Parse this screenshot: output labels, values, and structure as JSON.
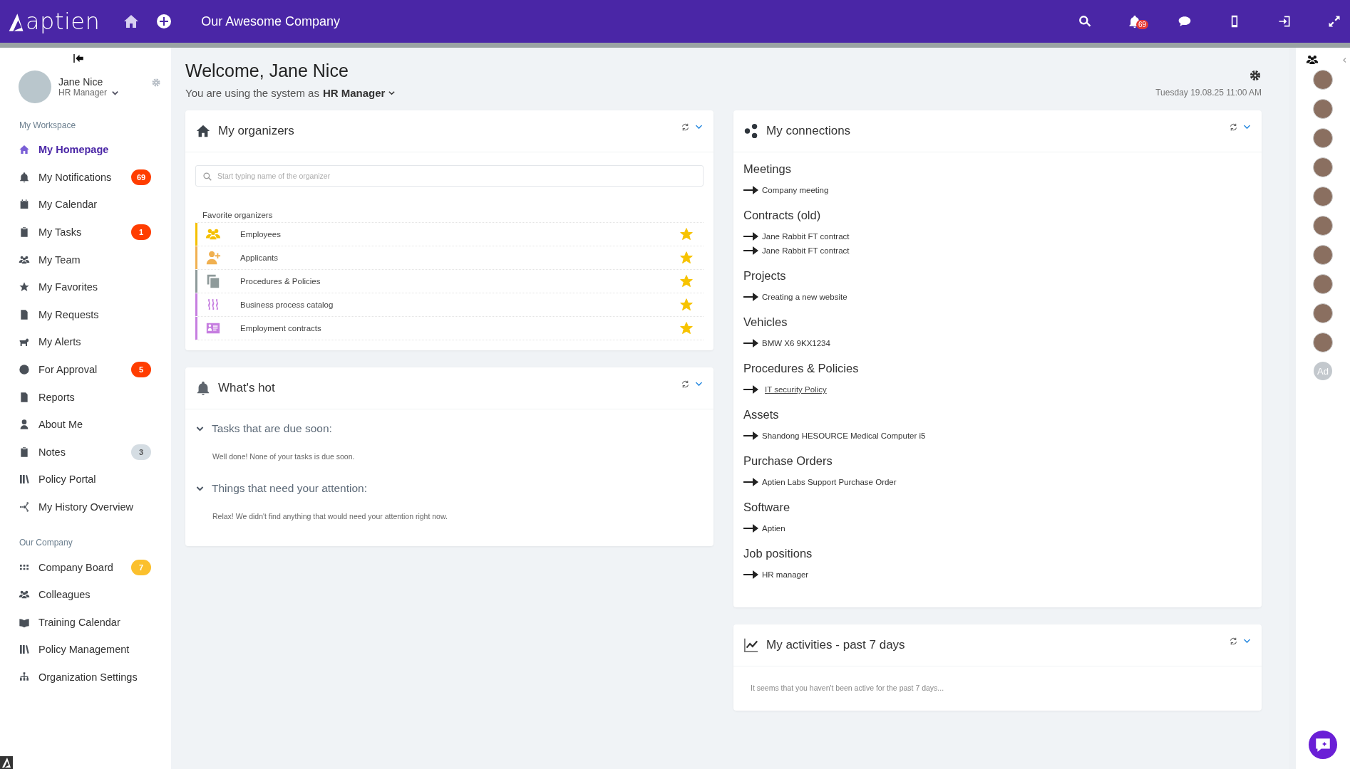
{
  "header": {
    "brand": "aptien",
    "company": "Our Awesome Company",
    "notifications_badge": "69"
  },
  "user": {
    "name": "Jane Nice",
    "role": "HR Manager"
  },
  "sidebar": {
    "sections": [
      {
        "title": "My Workspace",
        "items": [
          {
            "label": "My Homepage",
            "selected": true
          },
          {
            "label": "My Notifications",
            "selected": false,
            "badge": {
              "text": "69",
              "color": "#ff3d00"
            }
          },
          {
            "label": "My Calendar",
            "selected": false
          },
          {
            "label": "My Tasks",
            "selected": false,
            "badge": {
              "text": "1",
              "color": "#ff3d00"
            }
          },
          {
            "label": "My Team",
            "selected": false
          },
          {
            "label": "My Favorites",
            "selected": false
          },
          {
            "label": "My Requests",
            "selected": false
          },
          {
            "label": "My Alerts",
            "selected": false
          },
          {
            "label": "For Approval",
            "selected": false,
            "badge": {
              "text": "5",
              "color": "#ff3d00"
            }
          },
          {
            "label": "Reports",
            "selected": false
          },
          {
            "label": "About Me",
            "selected": false
          },
          {
            "label": "Notes",
            "selected": false,
            "badge": {
              "text": "3",
              "color": "#d5dde3"
            }
          },
          {
            "label": "Policy Portal",
            "selected": false
          },
          {
            "label": "My History Overview",
            "selected": false
          }
        ]
      },
      {
        "title": "Our Company",
        "items": [
          {
            "label": "Company Board",
            "selected": false,
            "badge": {
              "text": "7",
              "color": "#fbc02d"
            }
          },
          {
            "label": "Colleagues",
            "selected": false
          },
          {
            "label": "Training Calendar",
            "selected": false
          },
          {
            "label": "Policy Management",
            "selected": false
          },
          {
            "label": "Organization Settings",
            "selected": false
          }
        ]
      }
    ]
  },
  "welcome": {
    "title": "Welcome, Jane Nice",
    "role_prefix": "You are using the system as",
    "role": "HR Manager",
    "date": "Tuesday 19.08.25 11:00 AM"
  },
  "organizers": {
    "title": "My organizers",
    "search": {
      "placeholder": "Start typing name of the organizer"
    },
    "favorites_label": "Favorite organizers",
    "rows": [
      {
        "label": "Employees",
        "color": "#f5c000",
        "starred": true
      },
      {
        "label": "Applicants",
        "color": "#f0b050",
        "starred": true
      },
      {
        "label": "Procedures & Policies",
        "color": "#8e9a9a",
        "starred": true
      },
      {
        "label": "Business process catalog",
        "color": "#c67ee0",
        "starred": true
      },
      {
        "label": "Employment contracts",
        "color": "#c67ee0",
        "starred": true
      }
    ]
  },
  "whats_hot": {
    "title": "What's hot",
    "sections": [
      {
        "title": "Tasks that are due soon:",
        "expanded": true,
        "message": "Well done! None of your tasks is due soon."
      },
      {
        "title": "Things that need your attention:",
        "expanded": true,
        "message": "Relax! We didn't find anything that would need your attention right now."
      }
    ]
  },
  "connections": {
    "title": "My connections",
    "groups": [
      {
        "title": "Meetings",
        "items": [
          {
            "label": "Company meeting",
            "link": false
          }
        ]
      },
      {
        "title": "Contracts (old)",
        "items": [
          {
            "label": "Jane Rabbit FT contract",
            "link": false
          },
          {
            "label": "Jane Rabbit FT contract",
            "link": false
          }
        ]
      },
      {
        "title": "Projects",
        "items": [
          {
            "label": "Creating a new website",
            "link": false
          }
        ]
      },
      {
        "title": "Vehicles",
        "items": [
          {
            "label": "BMW X6 9KX1234",
            "link": false
          }
        ]
      },
      {
        "title": "Procedures & Policies",
        "items": [
          {
            "label": "IT security Policy",
            "link": true
          }
        ]
      },
      {
        "title": "Assets",
        "items": [
          {
            "label": "Shandong HESOURCE Medical Computer i5",
            "link": false
          }
        ]
      },
      {
        "title": "Purchase Orders",
        "items": [
          {
            "label": "Aptien Labs Support Purchase Order",
            "link": false
          }
        ]
      },
      {
        "title": "Software",
        "items": [
          {
            "label": "Aptien",
            "link": false
          }
        ]
      },
      {
        "title": "Job positions",
        "items": [
          {
            "label": "HR manager",
            "link": false
          }
        ]
      }
    ]
  },
  "activities": {
    "title": "My activities - past 7 days",
    "message": "It seems that you haven't been active for the past 7 days..."
  },
  "colleagues": [
    {
      "kind": "photo"
    },
    {
      "kind": "photo"
    },
    {
      "kind": "photo"
    },
    {
      "kind": "photo"
    },
    {
      "kind": "photo"
    },
    {
      "kind": "photo"
    },
    {
      "kind": "photo"
    },
    {
      "kind": "photo"
    },
    {
      "kind": "photo"
    },
    {
      "kind": "photo"
    },
    {
      "kind": "initials",
      "initials": "Ad"
    }
  ]
}
